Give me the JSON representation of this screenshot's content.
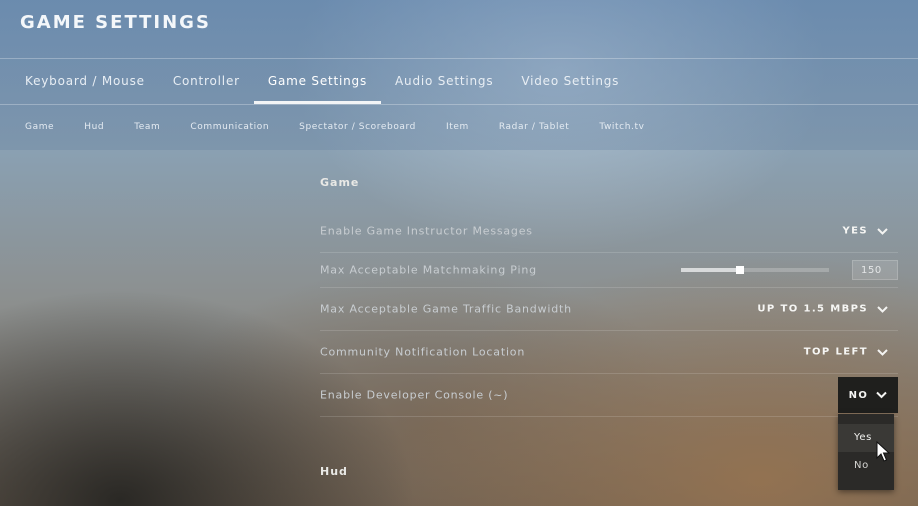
{
  "header": {
    "title": "GAME SETTINGS"
  },
  "tabs": [
    {
      "label": "Keyboard / Mouse",
      "active": false
    },
    {
      "label": "Controller",
      "active": false
    },
    {
      "label": "Game Settings",
      "active": true
    },
    {
      "label": "Audio Settings",
      "active": false
    },
    {
      "label": "Video Settings",
      "active": false
    }
  ],
  "subtabs": [
    {
      "label": "Game"
    },
    {
      "label": "Hud"
    },
    {
      "label": "Team"
    },
    {
      "label": "Communication"
    },
    {
      "label": "Spectator / Scoreboard"
    },
    {
      "label": "Item"
    },
    {
      "label": "Radar / Tablet"
    },
    {
      "label": "Twitch.tv"
    }
  ],
  "sections": {
    "game": {
      "title": "Game",
      "settings": [
        {
          "label": "Enable Game Instructor Messages",
          "value": "YES"
        },
        {
          "label": "Max Acceptable Matchmaking Ping",
          "value": "150",
          "slider_fraction": 0.4
        },
        {
          "label": "Max Acceptable Game Traffic Bandwidth",
          "value": "UP TO 1.5 MBPS"
        },
        {
          "label": "Community Notification Location",
          "value": "TOP LEFT"
        },
        {
          "label": "Enable Developer Console (~)",
          "value": "NO"
        }
      ]
    },
    "hud": {
      "title": "Hud"
    }
  },
  "dropdown": {
    "options": [
      "Yes",
      "No"
    ],
    "hovered": "Yes"
  },
  "icons": {
    "chevron": "chevron-down-icon",
    "cursor": "mouse-pointer-icon"
  },
  "colors": {
    "text_primary": "#f6f6f4",
    "text_label": "#c8cdd1",
    "dropdown_bg": "#1f1f1d"
  }
}
